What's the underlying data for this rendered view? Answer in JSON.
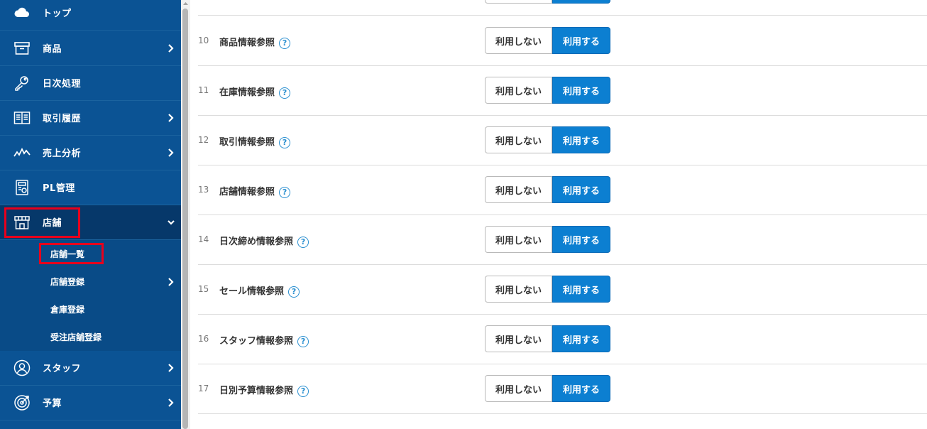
{
  "sidebar": {
    "items": [
      {
        "label": "トップ",
        "icon": "cloud-icon",
        "has_chevron": false
      },
      {
        "label": "商品",
        "icon": "box-icon",
        "has_chevron": true
      },
      {
        "label": "日次処理",
        "icon": "key-icon",
        "has_chevron": false
      },
      {
        "label": "取引履歴",
        "icon": "book-icon",
        "has_chevron": true
      },
      {
        "label": "売上分析",
        "icon": "line-chart-icon",
        "has_chevron": true
      },
      {
        "label": "PL管理",
        "icon": "report-icon",
        "has_chevron": false
      },
      {
        "label": "店舗",
        "icon": "store-icon",
        "has_chevron": true,
        "expanded": true
      },
      {
        "label": "スタッフ",
        "icon": "user-icon",
        "has_chevron": true
      },
      {
        "label": "予算",
        "icon": "target-icon",
        "has_chevron": true
      }
    ],
    "submenu": [
      {
        "label": "店舗一覧",
        "has_chevron": false
      },
      {
        "label": "店舗登録",
        "has_chevron": true
      },
      {
        "label": "倉庫登録",
        "has_chevron": false
      },
      {
        "label": "受注店舗登録",
        "has_chevron": false
      }
    ]
  },
  "permissions": {
    "off_label": "利用しない",
    "on_label": "利用する",
    "help_glyph": "?",
    "rows": [
      {
        "num": "10",
        "name": "商品情報参照"
      },
      {
        "num": "11",
        "name": "在庫情報参照"
      },
      {
        "num": "12",
        "name": "取引情報参照"
      },
      {
        "num": "13",
        "name": "店舗情報参照"
      },
      {
        "num": "14",
        "name": "日次締め情報参照"
      },
      {
        "num": "15",
        "name": "セール情報参照"
      },
      {
        "num": "16",
        "name": "スタッフ情報参照"
      },
      {
        "num": "17",
        "name": "日別予算情報参照"
      }
    ]
  },
  "colors": {
    "sidebar_bg": "#0b5394",
    "active_bg": "#06386a",
    "highlight": "#e8001c",
    "accent": "#0c7fd1"
  }
}
